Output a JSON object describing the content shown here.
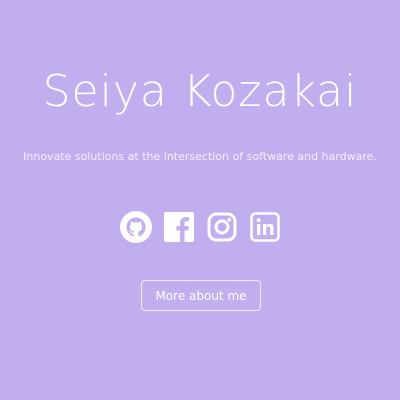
{
  "hero": {
    "name": "Seiya Kozakai",
    "tagline": "Innovate solutions at the intersection of software and hardware."
  },
  "socials": [
    {
      "icon": "github-icon"
    },
    {
      "icon": "facebook-icon"
    },
    {
      "icon": "instagram-icon"
    },
    {
      "icon": "linkedin-icon"
    }
  ],
  "cta": {
    "label": "More about me"
  },
  "colors": {
    "background": "#c1aeee",
    "foreground": "#ffffff"
  }
}
